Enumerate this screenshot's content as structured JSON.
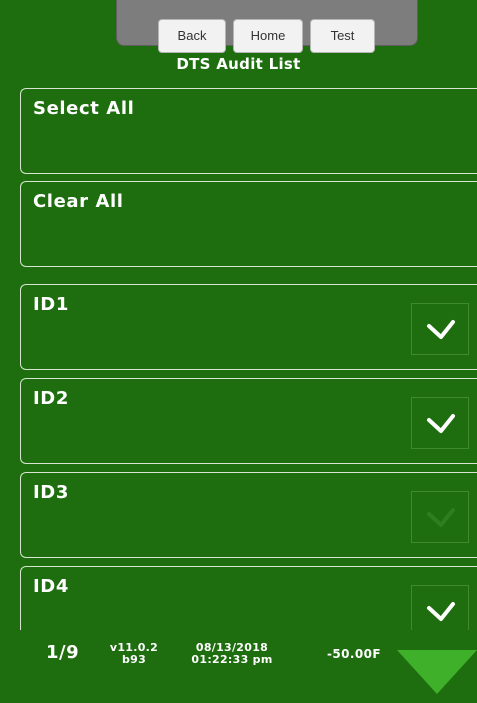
{
  "nav": {
    "back_label": "Back",
    "home_label": "Home",
    "test_label": "Test"
  },
  "title": "DTS Audit List",
  "rows": [
    {
      "label": "Select All"
    },
    {
      "label": "Clear All"
    },
    {
      "label": "ID1",
      "checked": true
    },
    {
      "label": "ID2",
      "checked": true
    },
    {
      "label": "ID3",
      "checked": false
    },
    {
      "label": "ID4",
      "checked": true
    }
  ],
  "footer": {
    "page": "1/9",
    "version": "v11.0.2",
    "build": "b93",
    "date": "08/13/2018",
    "time": "01:22:33 pm",
    "temperature": "-50.00F"
  },
  "colors": {
    "background": "#1e6e0f",
    "accent_light": "#3fb02a",
    "check_on": "#ffffff",
    "check_off": "#2c7f1c"
  }
}
